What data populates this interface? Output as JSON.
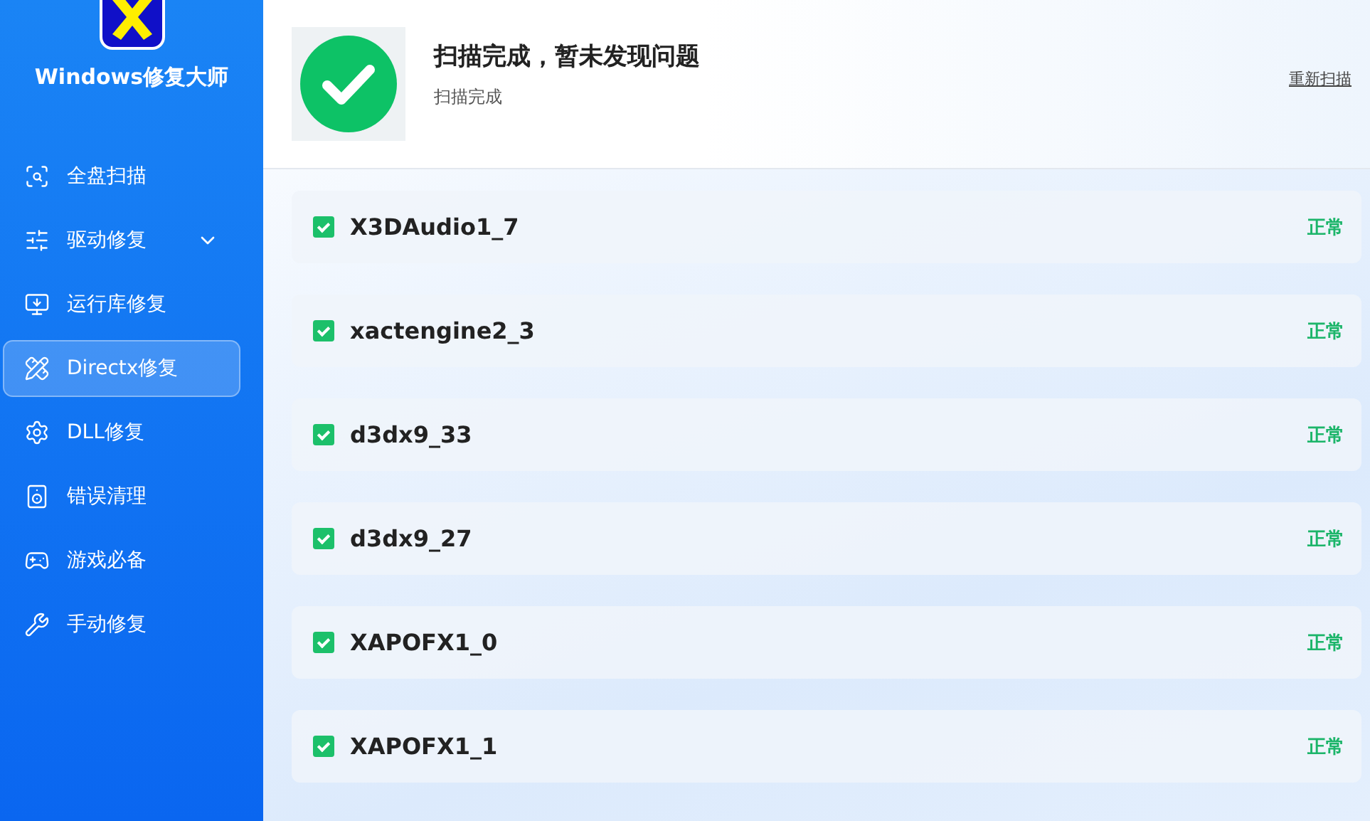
{
  "app": {
    "title": "Windows修复大师"
  },
  "nav": [
    {
      "label": "全盘扫描",
      "kind": "link",
      "selected": false
    },
    {
      "label": "驱动修复",
      "kind": "group",
      "selected": false
    },
    {
      "label": "运行库修复",
      "kind": "link",
      "selected": false
    },
    {
      "label": "Directx修复",
      "kind": "link",
      "selected": true
    },
    {
      "label": "DLL修复",
      "kind": "link",
      "selected": false
    },
    {
      "label": "错误清理",
      "kind": "link",
      "selected": false
    },
    {
      "label": "游戏必备",
      "kind": "link",
      "selected": false
    },
    {
      "label": "手动修复",
      "kind": "link",
      "selected": false
    }
  ],
  "result": {
    "title": "扫描完成，暂未发现问题",
    "subtitle": "扫描完成",
    "rescan": "重新扫描"
  },
  "items": [
    {
      "name": "X3DAudio1_7",
      "checked": true,
      "status": "正常"
    },
    {
      "name": "xactengine2_3",
      "checked": true,
      "status": "正常"
    },
    {
      "name": "d3dx9_33",
      "checked": true,
      "status": "正常"
    },
    {
      "name": "d3dx9_27",
      "checked": true,
      "status": "正常"
    },
    {
      "name": "XAPOFX1_0",
      "checked": true,
      "status": "正常"
    },
    {
      "name": "XAPOFX1_1",
      "checked": true,
      "status": "正常"
    }
  ]
}
